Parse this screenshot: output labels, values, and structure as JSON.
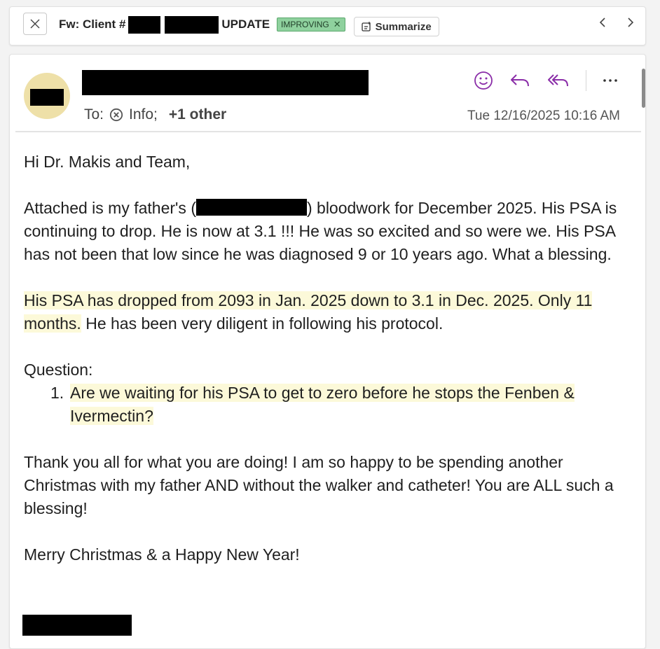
{
  "subject": {
    "prefix": "Fw: Client #",
    "suffix": "UPDATE",
    "tag_label": "IMPROVING",
    "tag_remove": "✕",
    "summarize_label": "Summarize"
  },
  "message": {
    "to_label": "To:",
    "recipient": "Info;",
    "others": "+1 other",
    "date": "Tue 12/16/2025 10:16 AM",
    "greeting": "Hi Dr. Makis and Team,",
    "para1_a": "Attached is my father's (",
    "para1_b": ") bloodwork for December 2025.  His PSA is continuing to drop.  He is now at 3.1 !!!  He was so excited and so were we.  His PSA has not been that low since he was diagnosed 9 or 10 years ago.  What a blessing.",
    "para2_highlight": "His PSA has dropped from 2093 in Jan. 2025 down to 3.1 in Dec. 2025. Only 11 months.",
    "para2_rest": "  He has been very diligent in following his protocol.",
    "question_label": "Question:",
    "question_number": "1.",
    "question_text": "Are we waiting for his PSA to get to zero before he stops the Fenben & Ivermectin?",
    "para3": "Thank you all for what you are doing!  I am so happy to be spending another Christmas with my father AND without the walker and catheter!  You are ALL such a blessing!",
    "closing": "Merry Christmas & a Happy New Year!"
  },
  "icons": {
    "close": "close-icon",
    "summarize": "sparkle-note-icon",
    "prev": "chevron-left-icon",
    "next": "chevron-right-icon",
    "emoji": "smiley-icon",
    "reply": "reply-icon",
    "reply_all": "reply-all-icon",
    "more": "more-icon",
    "remove_recipient": "remove-circle-icon"
  },
  "colors": {
    "accent_purple": "#8a2da8",
    "tag_green": "#8fd19e",
    "highlight": "#fcf9d9",
    "avatar_bg": "#eee0a8"
  }
}
